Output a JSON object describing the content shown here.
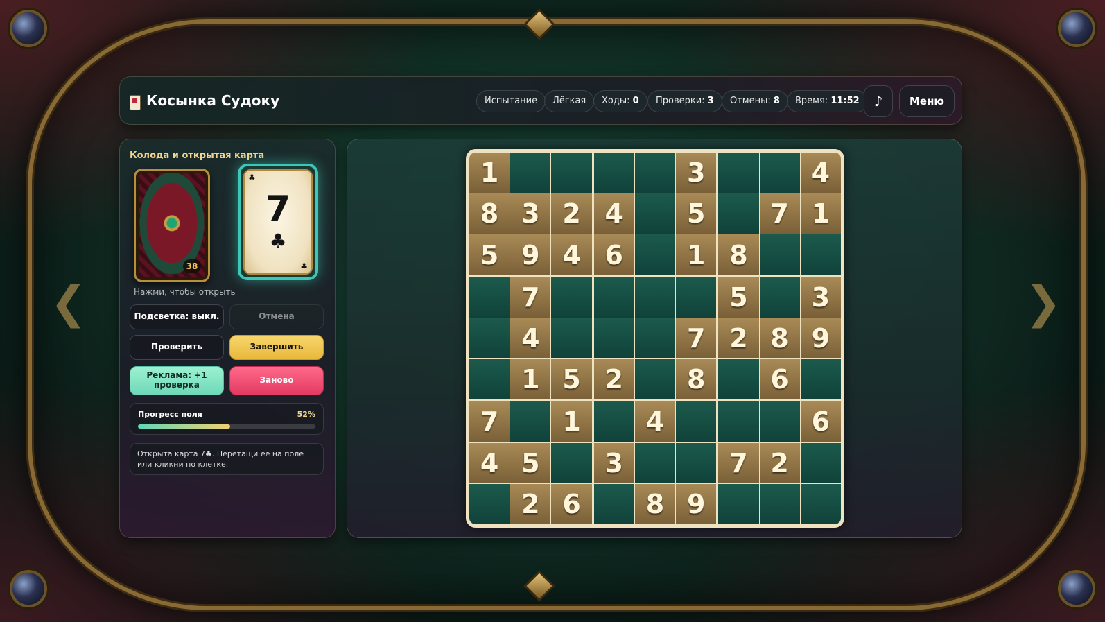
{
  "app": {
    "title": "Косынка Судоку"
  },
  "header": {
    "chips": [
      {
        "name": "mode-chip",
        "label": "Испытание",
        "value": ""
      },
      {
        "name": "difficulty-chip",
        "label": "Лёгкая",
        "value": ""
      },
      {
        "name": "moves-chip",
        "label": "Ходы:",
        "value": "0"
      },
      {
        "name": "checks-chip",
        "label": "Проверки:",
        "value": "3"
      },
      {
        "name": "undos-chip",
        "label": "Отмены:",
        "value": "8"
      },
      {
        "name": "time-chip",
        "label": "Время:",
        "value": "11:52"
      }
    ],
    "music_icon": "♪",
    "menu_label": "Меню"
  },
  "left": {
    "title": "Колода и открытая карта",
    "deck_count": "38",
    "open_card": {
      "rank": "7",
      "suit": "♣"
    },
    "hint": "Нажми, чтобы открыть",
    "buttons": {
      "highlight": "Подсветка: выкл.",
      "undo": "Отмена",
      "check": "Проверить",
      "finish": "Завершить",
      "ad": "Реклама: +1 проверка",
      "restart": "Заново"
    },
    "progress": {
      "label": "Прогресс поля",
      "percent_text": "52%",
      "value": 0.52
    },
    "message": "Открыта карта 7♣. Перетащи её на поле или кликни по клетке."
  },
  "board": {
    "rows": [
      [
        "1",
        "",
        "",
        "",
        "",
        "3",
        "",
        "",
        "4"
      ],
      [
        "8",
        "3",
        "2",
        "4",
        "",
        "5",
        "",
        "7",
        "1"
      ],
      [
        "5",
        "9",
        "4",
        "6",
        "",
        "1",
        "8",
        "",
        ""
      ],
      [
        "",
        "7",
        "",
        "",
        "",
        "",
        "5",
        "",
        "3"
      ],
      [
        "",
        "4",
        "",
        "",
        "",
        "7",
        "2",
        "8",
        "9"
      ],
      [
        "",
        "1",
        "5",
        "2",
        "",
        "8",
        "",
        "6",
        ""
      ],
      [
        "7",
        "",
        "1",
        "",
        "4",
        "",
        "",
        "",
        "6"
      ],
      [
        "4",
        "5",
        "",
        "3",
        "",
        "",
        "7",
        "2",
        ""
      ],
      [
        "",
        "2",
        "6",
        "",
        "8",
        "9",
        "",
        "",
        ""
      ]
    ]
  },
  "colors": {
    "accent_gold": "#f0d590",
    "teal": "#3cc7b6",
    "cell_empty": "#14483e",
    "cell_filled": "#8e7446"
  }
}
